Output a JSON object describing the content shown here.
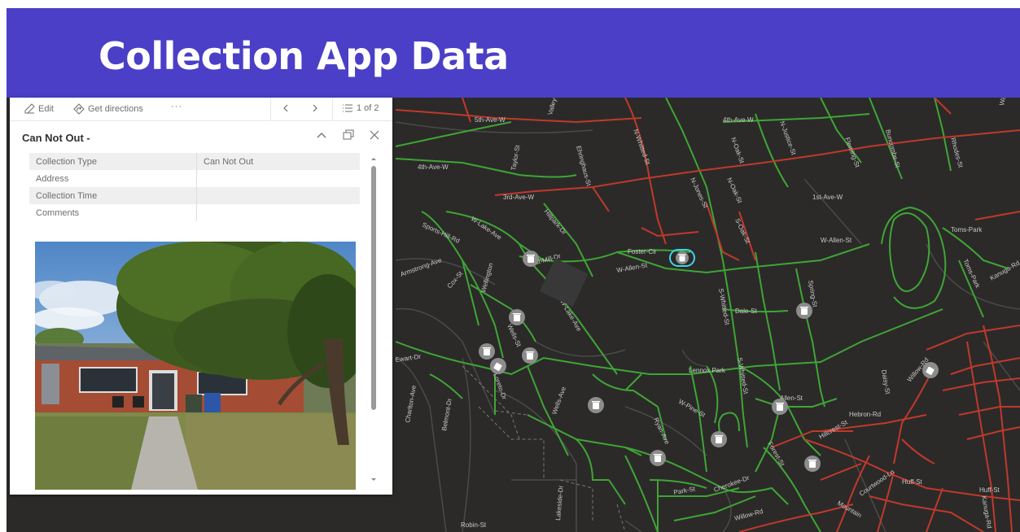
{
  "slide": {
    "title": "Collection App Data"
  },
  "popup": {
    "toolbar": {
      "edit_label": "Edit",
      "directions_label": "Get directions",
      "more_label": "···",
      "page_indicator": "1 of 2"
    },
    "title": "Can Not Out -",
    "attributes": [
      {
        "key": "Collection Type",
        "value": "Can Not Out"
      },
      {
        "key": "Address",
        "value": ""
      },
      {
        "key": "Collection Time",
        "value": ""
      },
      {
        "key": "Comments",
        "value": ""
      }
    ]
  },
  "map": {
    "colors": {
      "background": "#2b2a29",
      "road_collected": "#3fa535",
      "road_not_collected": "#c0392b",
      "road_other": "#4a4a4a",
      "marker": "#8c8c8c",
      "selected": "#3ed6e6"
    },
    "street_labels": [
      "5th-Ave-W",
      "4th-Ave-W",
      "Valley-St",
      "Ehringhaus-St",
      "N-Whitted-St",
      "N-Oak-St",
      "N-Justice-St",
      "Fleming-St",
      "Buncombe-St",
      "Rhodes-St",
      "Washington-St",
      "4th-Ave-W",
      "Taylor-St",
      "N-Jones-St",
      "N-Oak-St",
      "3rd-Ave-W",
      "Hillpark-Dr",
      "1st-Ave-W",
      "W-Lake-Ave",
      "Sports-Hill-Rd",
      "S-Oak-St",
      "W-Allen-St",
      "Toms-Park",
      "Grist-Mill-Dr",
      "Foster-Cir",
      "W-Allen-St",
      "Armstrong-Ave",
      "Cox-St",
      "Wellington",
      "W-Lake-Ave",
      "S-Whitted-St",
      "Spring-St",
      "Dale-St",
      "Toms-Park",
      "Kanuga-Rd",
      "Wells-St",
      "Ewart-Dr",
      "Lennox Park",
      "Willow-Rd",
      "Daisy-St",
      "Charlton-Ave",
      "Belmont-Dr",
      "Loreto-Dr",
      "Wells-Ave",
      "W-Pine-St",
      "S-Whitted-St",
      "Allen-St",
      "Hebron-Rd",
      "Ryan-Ave",
      "Hillcrest-St",
      "Forest-St",
      "Park-St",
      "Cherokee-Dr",
      "Huff-St",
      "Courtwood-Ln",
      "Mountain",
      "Kanuga-Rd",
      "Huff-St",
      "Robin-St",
      "Lakeside-Dr",
      "Willow-Rd"
    ]
  }
}
